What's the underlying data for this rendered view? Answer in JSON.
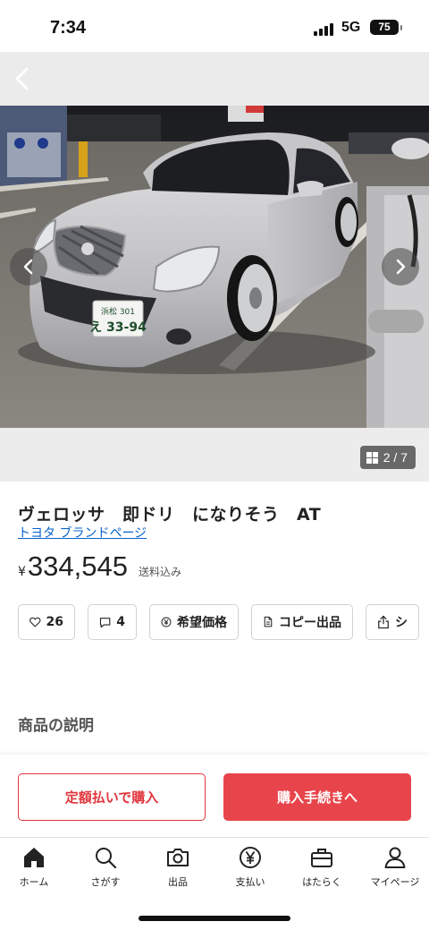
{
  "status_bar": {
    "time": "7:34",
    "network": "5G",
    "battery": "75"
  },
  "gallery": {
    "counter": "2 / 7",
    "plate_top": "浜松 301",
    "plate_bottom": "え 33-94"
  },
  "item": {
    "title": "ヴェロッサ　即ドリ　になりそう　AT",
    "brand_link": "トヨタ ブランドページ",
    "currency": "¥",
    "price": "334,545",
    "shipping": "送料込み"
  },
  "actions": [
    {
      "label": "26",
      "icon": "heart-icon"
    },
    {
      "label": "4",
      "icon": "comment-icon"
    },
    {
      "label": "希望価格",
      "icon": "yen-circle-icon"
    },
    {
      "label": "コピー出品",
      "icon": "copy-icon"
    },
    {
      "label": "シ",
      "icon": "share-icon"
    }
  ],
  "description": {
    "heading": "商品の説明"
  },
  "purchase": {
    "fixed_label": "定額払いで購入",
    "buy_label": "購入手続きへ"
  },
  "tabs": [
    {
      "label": "ホーム",
      "icon": "home-icon"
    },
    {
      "label": "さがす",
      "icon": "search-icon"
    },
    {
      "label": "出品",
      "icon": "camera-icon"
    },
    {
      "label": "支払い",
      "icon": "payment-icon"
    },
    {
      "label": "はたらく",
      "icon": "briefcase-icon"
    },
    {
      "label": "マイページ",
      "icon": "person-icon"
    }
  ],
  "colors": {
    "accent": "#e8444b",
    "link": "#0a63c9"
  }
}
